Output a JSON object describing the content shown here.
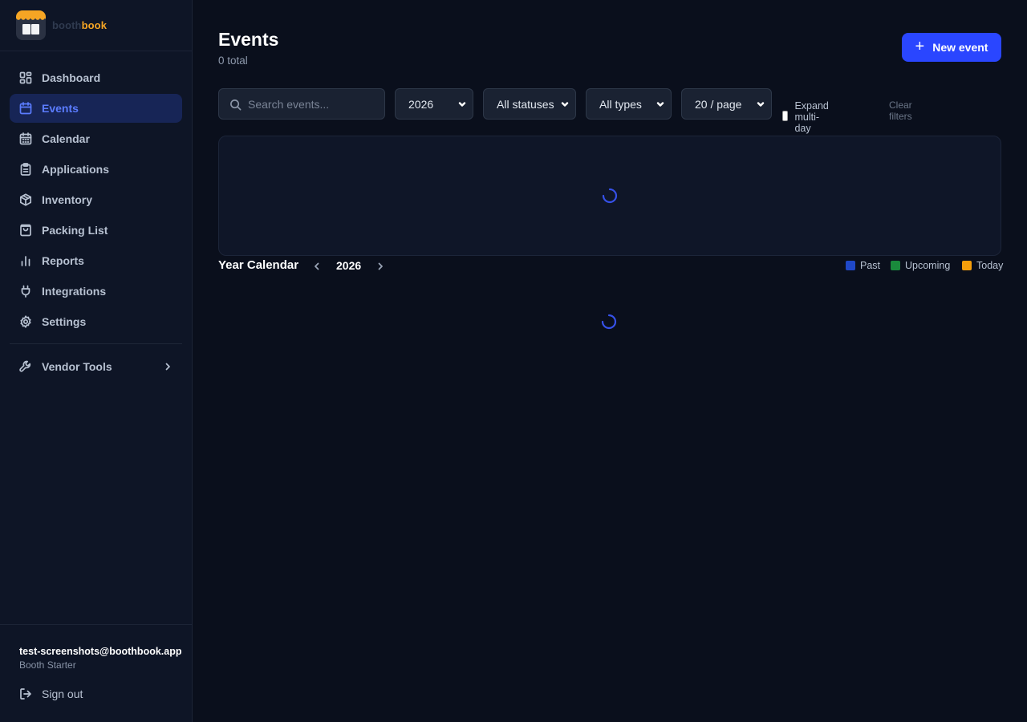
{
  "colors": {
    "accent": "#2a46ff",
    "active_nav_bg": "#172556",
    "active_nav_text": "#5b7cff",
    "brand_orange": "#f5a524",
    "page_bg": "#0a0f1c",
    "sidebar_bg": "#0e1526",
    "spinner": "#3651e8"
  },
  "brand": {
    "name_part1": "booth",
    "name_part2": "book",
    "logo_icon": "booth-awning-book-logo"
  },
  "sidebar": {
    "items": [
      {
        "label": "Dashboard",
        "icon": "dashboard-grid-icon"
      },
      {
        "label": "Events",
        "icon": "calendar-icon",
        "active": true
      },
      {
        "label": "Calendar",
        "icon": "calendar-grid-icon"
      },
      {
        "label": "Applications",
        "icon": "clipboard-icon"
      },
      {
        "label": "Inventory",
        "icon": "box-icon"
      },
      {
        "label": "Packing List",
        "icon": "bag-icon"
      },
      {
        "label": "Reports",
        "icon": "bar-chart-icon"
      },
      {
        "label": "Integrations",
        "icon": "plug-icon"
      },
      {
        "label": "Settings",
        "icon": "gear-icon"
      }
    ],
    "vendor_tools": {
      "label": "Vendor Tools",
      "icon": "wrench-icon"
    },
    "footer": {
      "email": "test-screenshots@boothbook.app",
      "plan": "Booth Starter",
      "sign_out": "Sign out"
    }
  },
  "header": {
    "title": "Events",
    "subtitle": "0 total",
    "new_button": "New event"
  },
  "filters": {
    "search_placeholder": "Search events...",
    "year": "2026",
    "status": "All statuses",
    "type": "All types",
    "per_page": "20 / page",
    "expand_label": "Expand multi-day",
    "expand_checked": false,
    "clear_label": "Clear filters"
  },
  "year_calendar": {
    "title": "Year Calendar",
    "year": "2026",
    "legend": [
      {
        "label": "Past",
        "color": "#1f48c8"
      },
      {
        "label": "Upcoming",
        "color": "#1a8a3c"
      },
      {
        "label": "Today",
        "color": "#f59e0b"
      }
    ]
  }
}
